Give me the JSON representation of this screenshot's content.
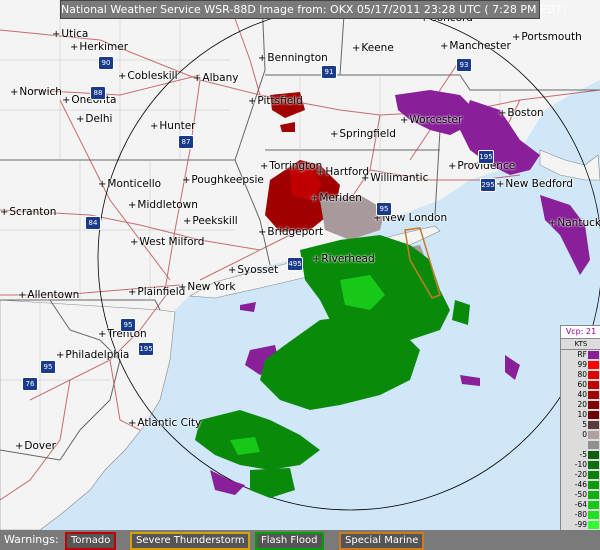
{
  "header": {
    "title": "National Weather Service WSR-88D Image from: OKX 05/17/2011  23:28 UTC  ( 7:28 PM EDT)"
  },
  "colors": {
    "water": "#cfe7f8",
    "land": "#f4f4f4",
    "state_border": "#777777",
    "county_border": "#bdbdbd",
    "road": "#b03030",
    "interstate": "#1a3a8c",
    "range_ring": "#000000"
  },
  "cities": [
    {
      "name": "Utica"
    },
    {
      "name": "Herkimer"
    },
    {
      "name": "Cobleskill"
    },
    {
      "name": "Albany"
    },
    {
      "name": "Bennington"
    },
    {
      "name": "Keene"
    },
    {
      "name": "Concord"
    },
    {
      "name": "Manchester"
    },
    {
      "name": "Portsmouth"
    },
    {
      "name": "Norwich"
    },
    {
      "name": "Oneonta"
    },
    {
      "name": "Delhi"
    },
    {
      "name": "Pittsfield"
    },
    {
      "name": "Worcester"
    },
    {
      "name": "Boston"
    },
    {
      "name": "Hunter"
    },
    {
      "name": "Springfield"
    },
    {
      "name": "Torrington"
    },
    {
      "name": "Hartford"
    },
    {
      "name": "Willimantic"
    },
    {
      "name": "Providence"
    },
    {
      "name": "New Bedford"
    },
    {
      "name": "Monticello"
    },
    {
      "name": "Poughkeepsie"
    },
    {
      "name": "Meriden"
    },
    {
      "name": "New London"
    },
    {
      "name": "Nantucket"
    },
    {
      "name": "Scranton"
    },
    {
      "name": "Middletown"
    },
    {
      "name": "Peekskill"
    },
    {
      "name": "Bridgeport"
    },
    {
      "name": "West Milford"
    },
    {
      "name": "Riverhead"
    },
    {
      "name": "Syosset"
    },
    {
      "name": "Allentown"
    },
    {
      "name": "Plainfield"
    },
    {
      "name": "New York"
    },
    {
      "name": "Trenton"
    },
    {
      "name": "Philadelphia"
    },
    {
      "name": "Atlantic City"
    },
    {
      "name": "Dover"
    }
  ],
  "highways": [
    {
      "label": "90",
      "kind": "interstate"
    },
    {
      "label": "88",
      "kind": "interstate"
    },
    {
      "label": "91",
      "kind": "interstate"
    },
    {
      "label": "93",
      "kind": "interstate"
    },
    {
      "label": "87",
      "kind": "interstate"
    },
    {
      "label": "84",
      "kind": "interstate"
    },
    {
      "label": "95",
      "kind": "interstate"
    },
    {
      "label": "195",
      "kind": "interstate"
    },
    {
      "label": "295",
      "kind": "interstate"
    },
    {
      "label": "195",
      "kind": "interstate"
    },
    {
      "label": "495",
      "kind": "interstate"
    },
    {
      "label": "76",
      "kind": "interstate"
    },
    {
      "label": "95",
      "kind": "interstate"
    },
    {
      "label": "95",
      "kind": "interstate"
    }
  ],
  "legend": {
    "product": "Vcp: 21",
    "units": "KTS",
    "entries": [
      {
        "label": "RF",
        "color": "#8a1f9a"
      },
      {
        "label": "99",
        "color": "#ff0000"
      },
      {
        "label": "80",
        "color": "#e00000"
      },
      {
        "label": "60",
        "color": "#c00000"
      },
      {
        "label": "40",
        "color": "#a00000"
      },
      {
        "label": "20",
        "color": "#800000"
      },
      {
        "label": "10",
        "color": "#6e0000"
      },
      {
        "label": "5",
        "color": "#5a3a3a"
      },
      {
        "label": "0",
        "color": "#b0a0a0"
      },
      {
        "label": "",
        "color": "#909090"
      },
      {
        "label": "-5",
        "color": "#0f5f0f"
      },
      {
        "label": "-10",
        "color": "#0c6f0c"
      },
      {
        "label": "-20",
        "color": "#0a7f0a"
      },
      {
        "label": "-46",
        "color": "#0a9a0a"
      },
      {
        "label": "-50",
        "color": "#10b010"
      },
      {
        "label": "-64",
        "color": "#18c818"
      },
      {
        "label": "-80",
        "color": "#20e020"
      },
      {
        "label": "-99",
        "color": "#30ff30"
      },
      {
        "label": "ND",
        "color": "#ffffff"
      }
    ]
  },
  "warnings": {
    "title": "Warnings:",
    "items": [
      {
        "label": "Tornado",
        "color": "#ff0000"
      },
      {
        "label": "Severe Thunderstorm",
        "color": "#ffa500"
      },
      {
        "label": "Flash Flood",
        "color": "#00c000"
      },
      {
        "label": "Special Marine",
        "color": "#ff8c00"
      }
    ]
  }
}
